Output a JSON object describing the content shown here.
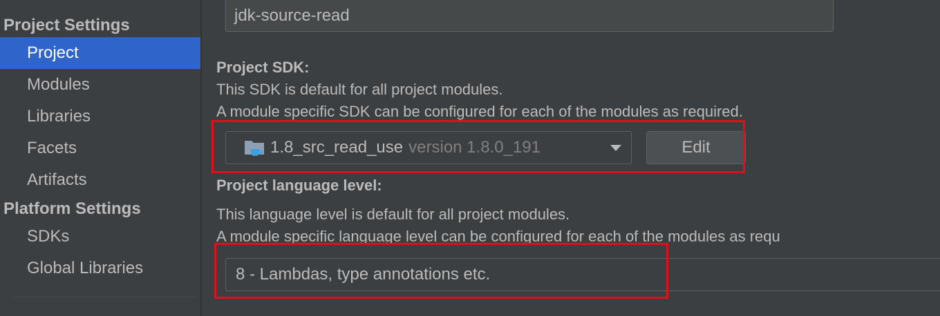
{
  "sidebar": {
    "project_settings_header": "Project Settings",
    "project_settings_items": [
      {
        "label": "Project",
        "selected": true
      },
      {
        "label": "Modules"
      },
      {
        "label": "Libraries"
      },
      {
        "label": "Facets"
      },
      {
        "label": "Artifacts"
      }
    ],
    "platform_settings_header": "Platform Settings",
    "platform_settings_items": [
      {
        "label": "SDKs"
      },
      {
        "label": "Global Libraries"
      }
    ]
  },
  "main": {
    "project_name_value": "jdk-source-read",
    "project_sdk": {
      "label": "Project SDK:",
      "desc_line1": "This SDK is default for all project modules.",
      "desc_line2": "A module specific SDK can be configured for each of the modules as required.",
      "selected_sdk_name": "1.8_src_read_use",
      "selected_sdk_version": "version 1.8.0_191",
      "edit_label": "Edit"
    },
    "language_level": {
      "label": "Project language level:",
      "desc_line1": "This language level is default for all project modules.",
      "desc_line2": "A module specific language level can be configured for each of the modules as requ",
      "selected_value": "8 - Lambdas, type annotations etc."
    }
  },
  "colors": {
    "background": "#3c3f41",
    "selection": "#2f65ca",
    "text": "#bbbbbb",
    "highlight_annotation": "#e0101a",
    "jdk_icon_folder": "#8ea0b3",
    "jdk_icon_cup": "#3d9fe0"
  },
  "icons": {
    "sdk": "jdk-folder-icon",
    "dropdown": "chevron-down-icon"
  }
}
